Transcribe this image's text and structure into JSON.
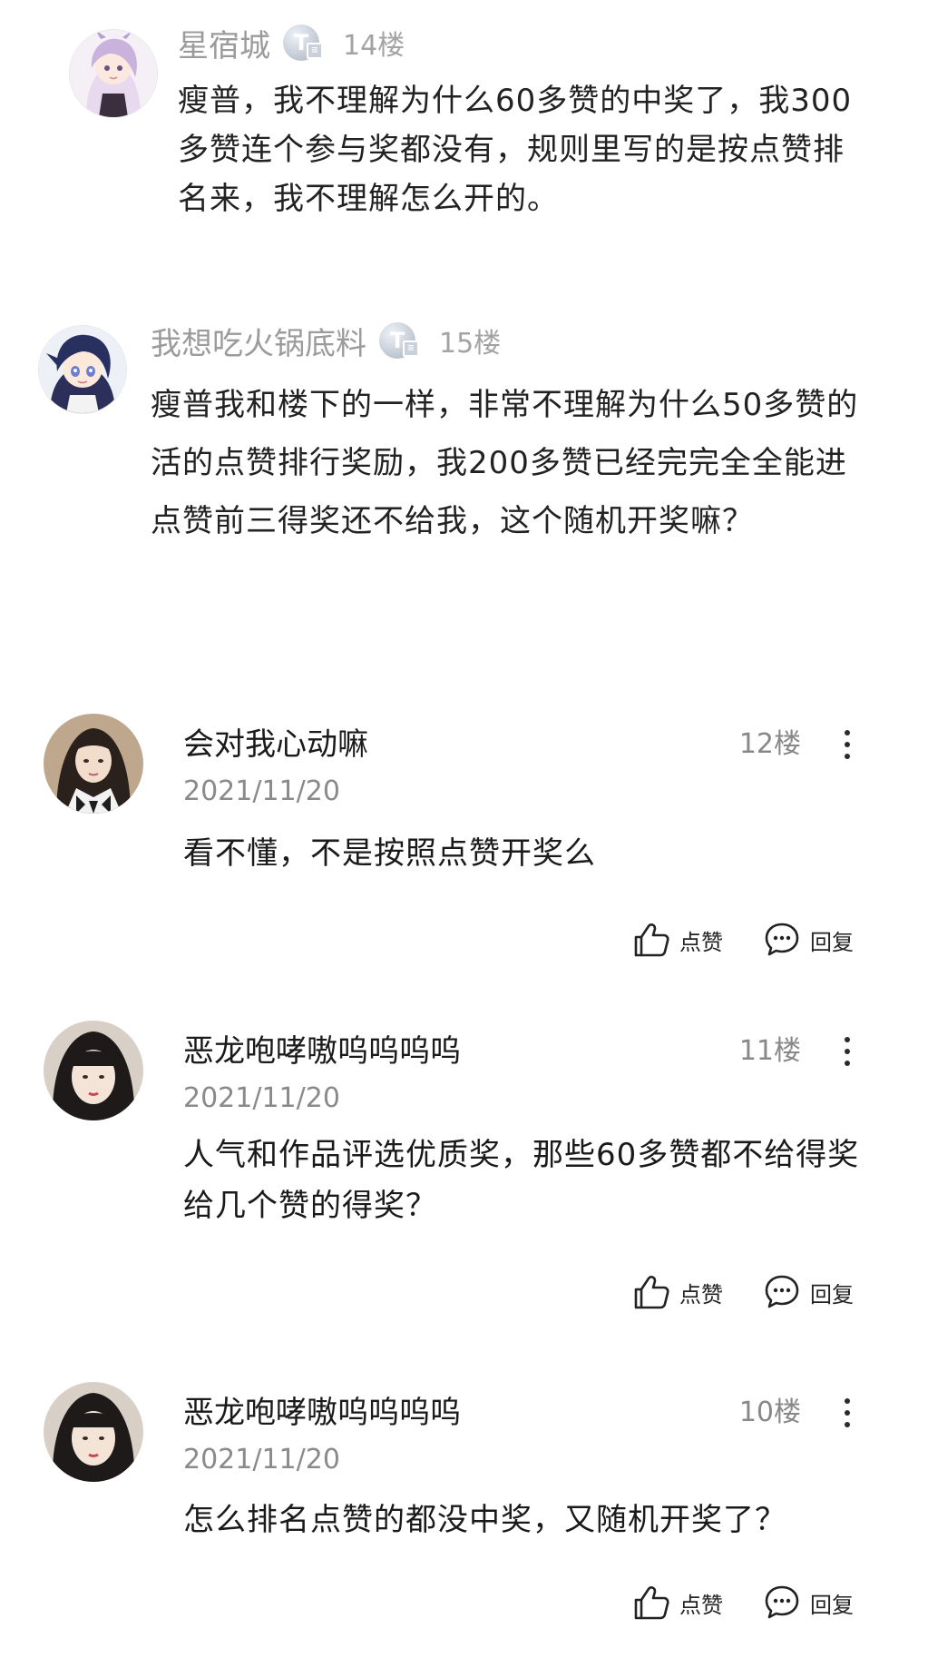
{
  "quoted_comments": [
    {
      "username": "星宿城",
      "badge": "T",
      "floor": "14楼",
      "text": "瘦普，我不理解为什么60多赞的中奖了，我300多赞连个参与奖都没有，规则里写的是按点赞排名来，我不理解怎么开的。"
    },
    {
      "username": "我想吃火锅底料",
      "badge": "T",
      "floor": "15楼",
      "text": "瘦普我和楼下的一样，非常不理解为什么50多赞的活的点赞排行奖励，我200多赞已经完完全全能进点赞前三得奖还不给我，这个随机开奖嘛？"
    }
  ],
  "comments": [
    {
      "username": "会对我心动嘛",
      "floor": "12楼",
      "date": "2021/11/20",
      "text": "看不懂，不是按照点赞开奖么",
      "like_label": "点赞",
      "reply_label": "回复"
    },
    {
      "username": "恶龙咆哮嗷呜呜呜呜",
      "floor": "11楼",
      "date": "2021/11/20",
      "text": "人气和作品评选优质奖，那些60多赞都不给得奖给几个赞的得奖？",
      "like_label": "点赞",
      "reply_label": "回复"
    },
    {
      "username": "恶龙咆哮嗷呜呜呜呜",
      "floor": "10楼",
      "date": "2021/11/20",
      "text": "怎么排名点赞的都没中奖，又随机开奖了？",
      "like_label": "点赞",
      "reply_label": "回复"
    }
  ],
  "icons": {
    "like": "thumbs-up-icon",
    "reply": "speech-bubble-icon",
    "more": "more-vertical-icon",
    "badge": "level-badge-icon"
  },
  "colors": {
    "quote_name": "#9b9b9b",
    "floor": "#888888",
    "text": "#1a1a1a",
    "date": "#8a8a8a"
  }
}
